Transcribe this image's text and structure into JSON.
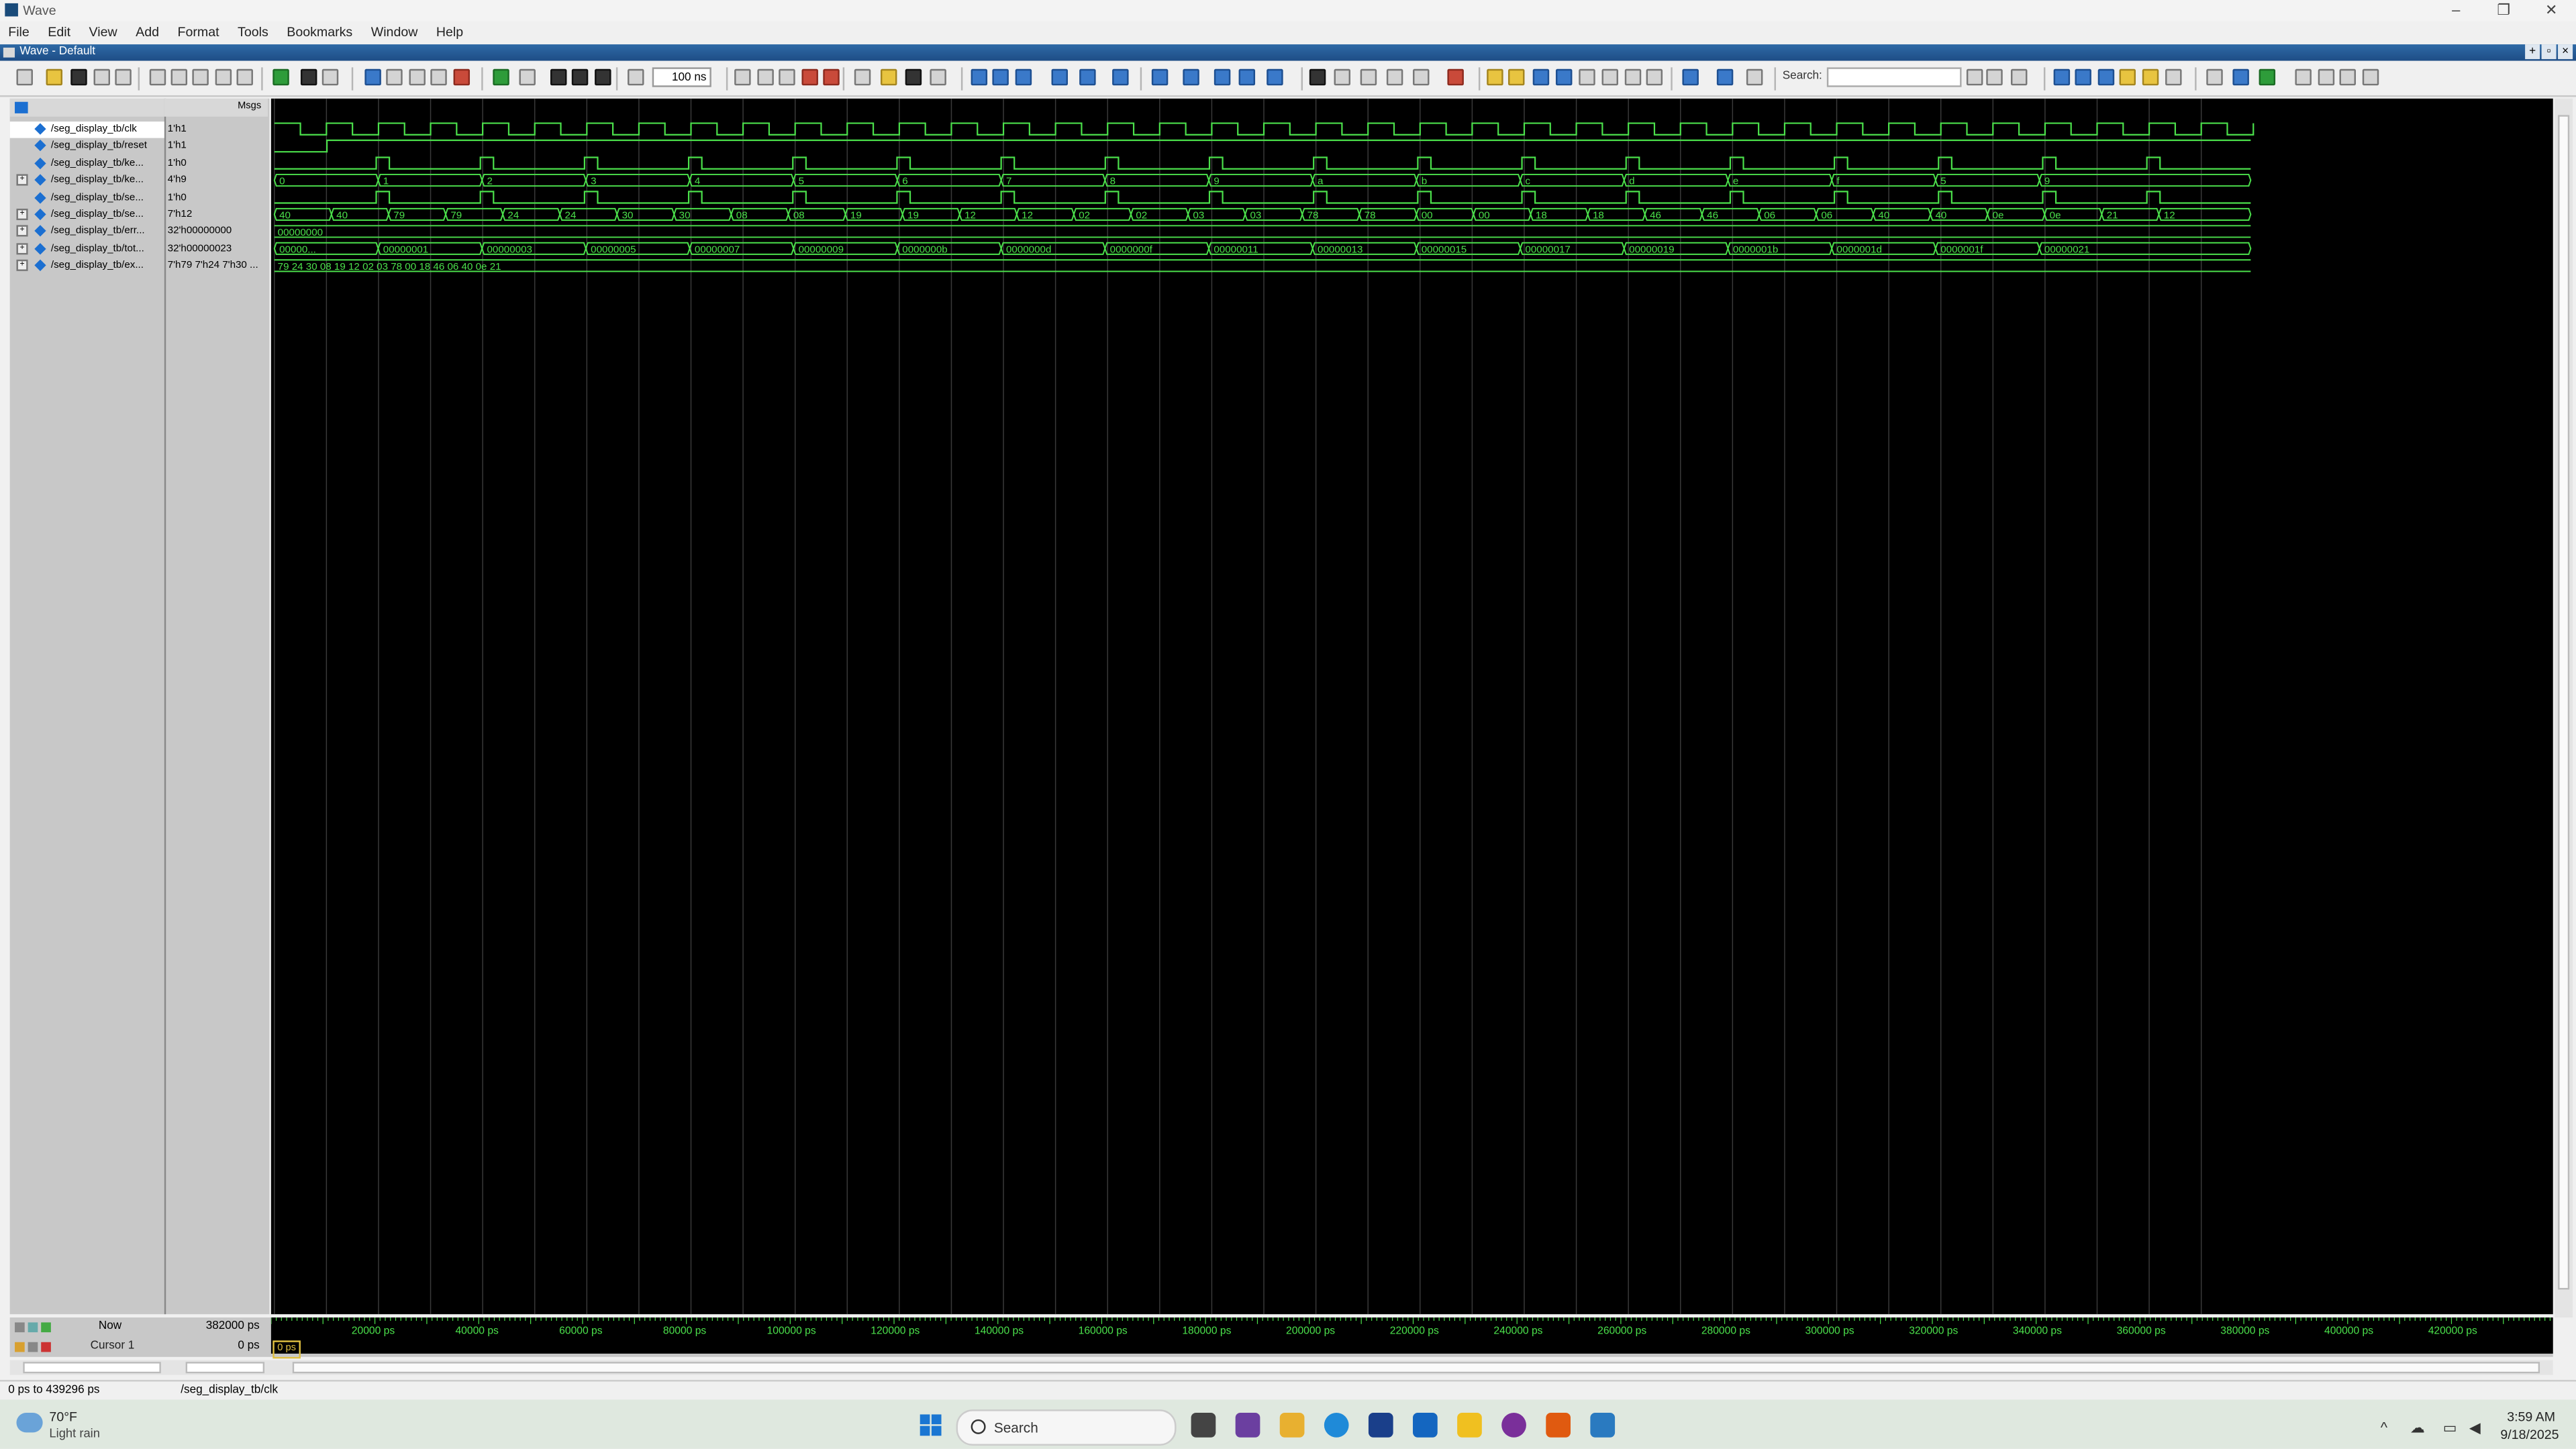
{
  "window": {
    "title": "Wave",
    "subtitle": "Wave - Default"
  },
  "menu": [
    "File",
    "Edit",
    "View",
    "Add",
    "Format",
    "Tools",
    "Bookmarks",
    "Window",
    "Help"
  ],
  "toolbar": {
    "zoom_value": "100",
    "zoom_unit": "ns",
    "search_label": "Search:"
  },
  "header": {
    "msgs_label": "Msgs"
  },
  "signals": [
    {
      "name": "/seg_display_tb/clk",
      "value": "1'h1",
      "expandable": false
    },
    {
      "name": "/seg_display_tb/reset",
      "value": "1'h1",
      "expandable": false
    },
    {
      "name": "/seg_display_tb/ke...",
      "value": "1'h0",
      "expandable": false
    },
    {
      "name": "/seg_display_tb/ke...",
      "value": "4'h9",
      "expandable": true
    },
    {
      "name": "/seg_display_tb/se...",
      "value": "1'h0",
      "expandable": false
    },
    {
      "name": "/seg_display_tb/se...",
      "value": "7'h12",
      "expandable": true
    },
    {
      "name": "/seg_display_tb/err...",
      "value": "32'h00000000",
      "expandable": true
    },
    {
      "name": "/seg_display_tb/tot...",
      "value": "32'h00000023",
      "expandable": true
    },
    {
      "name": "/seg_display_tb/ex...",
      "value": "7'h79 7'h24 7'h30 ...",
      "expandable": true
    }
  ],
  "bus_labels": {
    "key_hex": [
      "0",
      "1",
      "2",
      "3",
      "4",
      "5",
      "6",
      "7",
      "8",
      "9",
      "a",
      "b",
      "c",
      "d",
      "e",
      "f",
      "5",
      "9"
    ],
    "seg_hex": [
      "40",
      "40",
      "79",
      "79",
      "24",
      "24",
      "30",
      "30",
      "08",
      "08",
      "19",
      "19",
      "12",
      "12",
      "02",
      "02",
      "03",
      "03",
      "78",
      "78",
      "00",
      "00",
      "18",
      "18",
      "46",
      "46",
      "06",
      "06",
      "40",
      "40",
      "0e",
      "0e",
      "21",
      "12"
    ],
    "err": "00000000",
    "total": [
      "00000...",
      "00000001",
      "00000003",
      "00000005",
      "00000007",
      "00000009",
      "0000000b",
      "0000000d",
      "0000000f",
      "00000011",
      "00000013",
      "00000015",
      "00000017",
      "00000019",
      "0000001b",
      "0000001d",
      "0000001f",
      "00000021"
    ],
    "expected": "79 24 30 08 19 12 02 03 78 00 18 46 06 40 0e 21"
  },
  "cursor": {
    "now_label": "Now",
    "now_value": "382000 ps",
    "cursor_label": "Cursor 1",
    "cursor_value": "0 ps",
    "cursor_box": "0 ps"
  },
  "axis_labels": [
    "20000 ps",
    "40000 ps",
    "60000 ps",
    "80000 ps",
    "100000 ps",
    "120000 ps",
    "140000 ps",
    "160000 ps",
    "180000 ps",
    "200000 ps",
    "220000 ps",
    "240000 ps",
    "260000 ps",
    "280000 ps",
    "300000 ps",
    "320000 ps",
    "340000 ps",
    "360000 ps",
    "380000 ps",
    "400000 ps",
    "420000 ps"
  ],
  "status": {
    "range": "0 ps to 439296 ps",
    "selected": "/seg_display_tb/clk"
  },
  "taskbar": {
    "temp": "70°F",
    "weather": "Light rain",
    "search": "Search",
    "time": "3:59 AM",
    "date": "9/18/2025"
  },
  "colors": {
    "wave": "#4be04b",
    "background": "#000000",
    "cursor": "#e0c040",
    "title_bar": "#2e6aa6"
  }
}
